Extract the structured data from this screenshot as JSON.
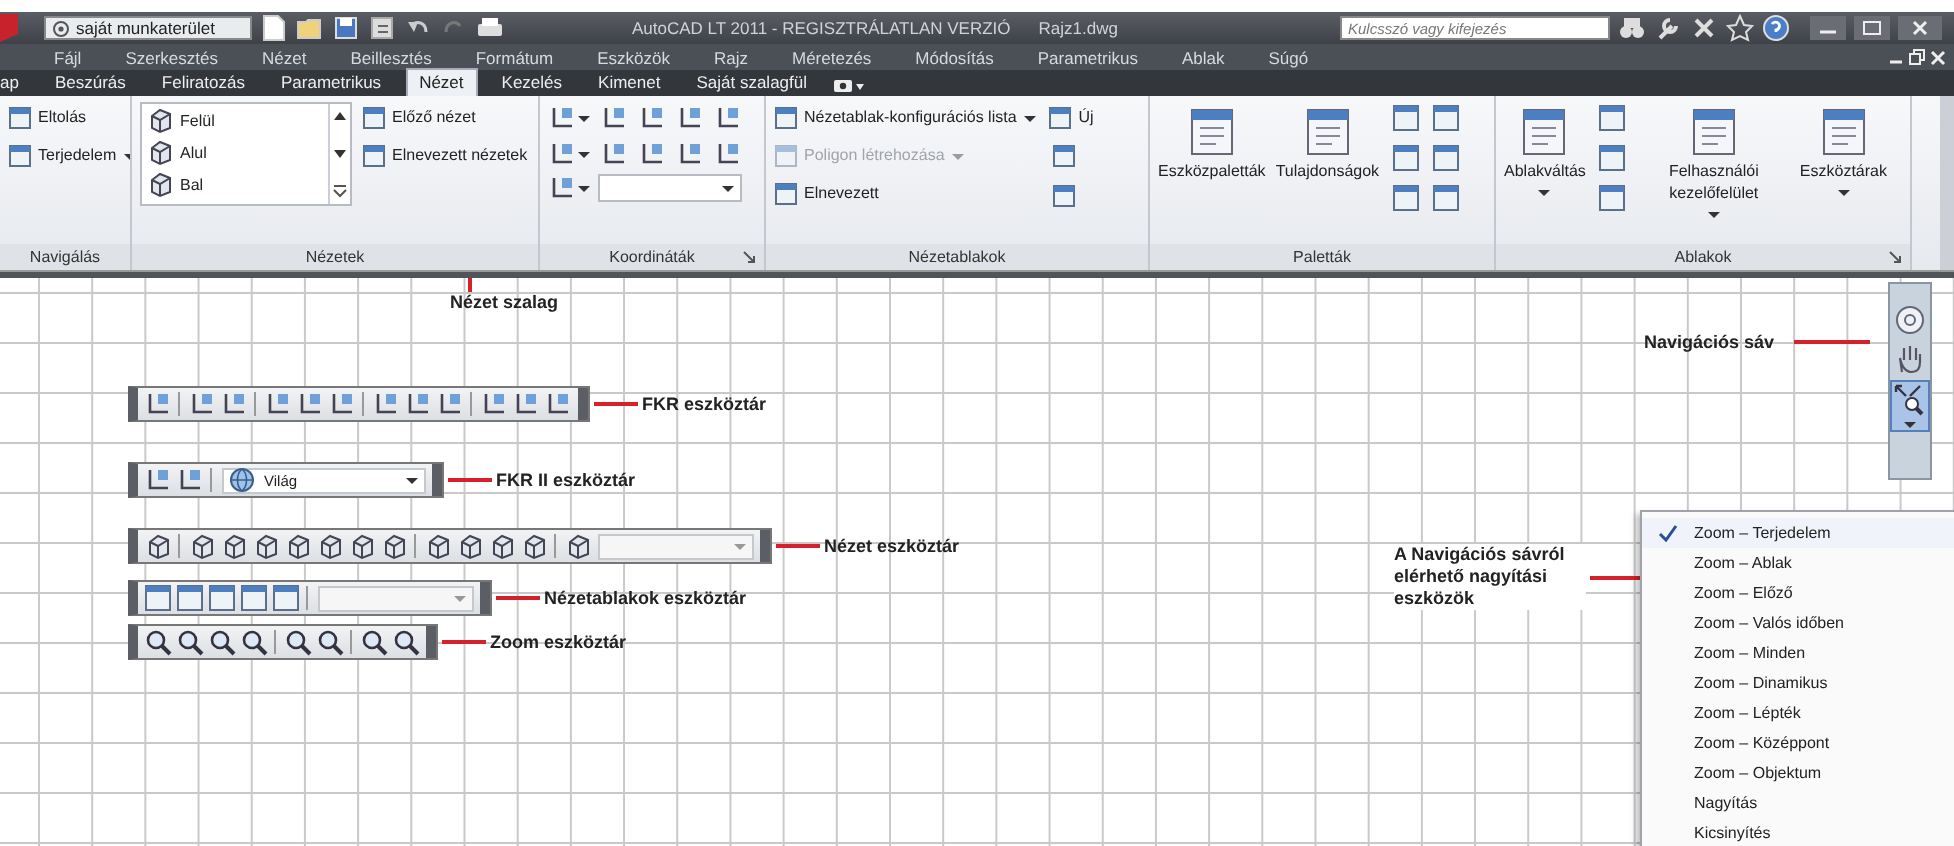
{
  "title_bar": {
    "workspace": "saját munkaterület",
    "title": "AutoCAD LT 2011 - REGISZTRÁLATLAN VERZIÓ",
    "file": "Rajz1.dwg",
    "search": {
      "placeholder": "Kulcsszó vagy kifejezés"
    }
  },
  "menu_bar": [
    "Fájl",
    "Szerkesztés",
    "Nézet",
    "Beillesztés",
    "Formátum",
    "Eszközök",
    "Rajz",
    "Méretezés",
    "Módosítás",
    "Parametrikus",
    "Ablak",
    "Súgó"
  ],
  "ribbon_tabs": [
    {
      "label": "ap",
      "selected": false
    },
    {
      "label": "Beszúrás",
      "selected": false
    },
    {
      "label": "Feliratozás",
      "selected": false
    },
    {
      "label": "Parametrikus",
      "selected": false
    },
    {
      "label": "Nézet",
      "selected": true
    },
    {
      "label": "Kezelés",
      "selected": false
    },
    {
      "label": "Kimenet",
      "selected": false
    },
    {
      "label": "Saját szalagfül",
      "selected": false
    }
  ],
  "ribbon_panels": [
    {
      "title": "Navigálás",
      "columns": [
        [
          {
            "kind": "small",
            "label": "Eltolás"
          },
          {
            "kind": "small",
            "label": "Terjedelem",
            "dropdown": true
          }
        ]
      ]
    },
    {
      "title": "Nézetek",
      "columns": [
        [
          {
            "kind": "list",
            "items": [
              "Felül",
              "Alul",
              "Bal"
            ]
          }
        ],
        [
          {
            "kind": "small",
            "label": "Előző nézet"
          },
          {
            "kind": "small",
            "label": "Elnevezett nézetek"
          }
        ]
      ]
    },
    {
      "title": "Koordináták",
      "launcher": true,
      "columns": [
        [
          {
            "kind": "ucs-tools"
          }
        ]
      ]
    },
    {
      "title": "Nézetablakok",
      "columns": [
        [
          {
            "kind": "small",
            "label": "Nézetablak-konfigurációs lista",
            "dropdown": true
          },
          {
            "kind": "small",
            "label": "Poligon létrehozása",
            "dropdown": true,
            "disabled": true
          },
          {
            "kind": "small",
            "label": "Elnevezett"
          }
        ],
        [
          {
            "kind": "small",
            "label": "Új"
          },
          {
            "kind": "icon"
          },
          {
            "kind": "icon"
          }
        ]
      ]
    },
    {
      "title": "Paletták",
      "columns": [
        [
          {
            "kind": "large",
            "label": "Eszközpaletták"
          }
        ],
        [
          {
            "kind": "large",
            "label": "Tulajdonságok"
          }
        ],
        [
          {
            "kind": "icon-grid"
          }
        ]
      ]
    },
    {
      "title": "Ablakok",
      "launcher": true,
      "columns": [
        [
          {
            "kind": "large",
            "label": "Ablakváltás",
            "dropdown": true
          }
        ],
        [
          {
            "kind": "icon-column"
          }
        ],
        [
          {
            "kind": "large",
            "label": "Felhasználói kezelőfelület",
            "dropdown": true
          }
        ],
        [
          {
            "kind": "large",
            "label": "Eszköztárak",
            "dropdown": true
          }
        ]
      ]
    }
  ],
  "canvas": {
    "ribbon_callout": "Nézet szalag",
    "toolbars": [
      {
        "callout": "FKR eszköztár",
        "kind": "icons"
      },
      {
        "callout": "FKR II eszköztár",
        "kind": "icons_combo",
        "combo_value": "Világ"
      },
      {
        "callout": "Nézet eszköztár",
        "kind": "icons_combo"
      },
      {
        "callout": "Nézetablakok eszköztár",
        "kind": "icons_combo"
      },
      {
        "callout": "Zoom eszköztár",
        "kind": "icons"
      }
    ],
    "navigation_bar": {
      "callout": "Navigációs sáv"
    },
    "zoom_menu": {
      "callout": "A Navigációs sávról elérhető nagyítási eszközök",
      "items": [
        {
          "label": "Zoom – Terjedelem",
          "checked": true
        },
        {
          "label": "Zoom – Ablak",
          "checked": false
        },
        {
          "label": "Zoom – Előző",
          "checked": false
        },
        {
          "label": "Zoom – Valós időben",
          "checked": false
        },
        {
          "label": "Zoom – Minden",
          "checked": false
        },
        {
          "label": "Zoom – Dinamikus",
          "checked": false
        },
        {
          "label": "Zoom – Lépték",
          "checked": false
        },
        {
          "label": "Zoom – Középpont",
          "checked": false
        },
        {
          "label": "Zoom – Objektum",
          "checked": false
        },
        {
          "label": "Nagyítás",
          "checked": false
        },
        {
          "label": "Kicsinyítés",
          "checked": false
        }
      ]
    }
  }
}
